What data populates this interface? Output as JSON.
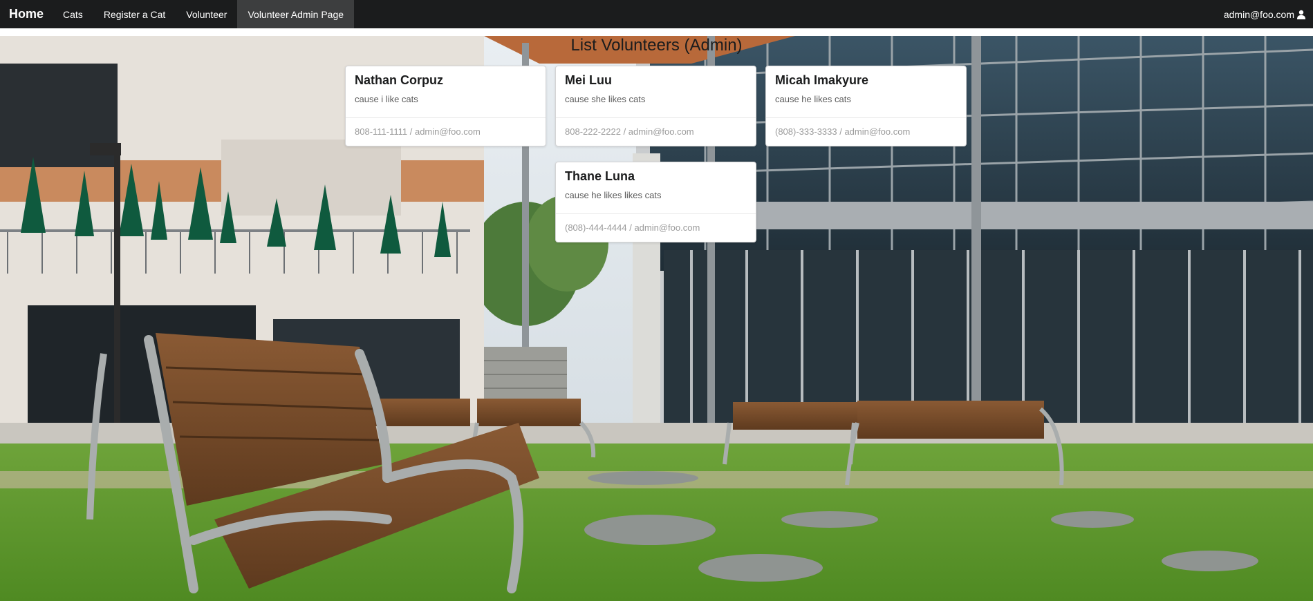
{
  "nav": {
    "brand": "Home",
    "items": [
      {
        "label": "Cats"
      },
      {
        "label": "Register a Cat"
      },
      {
        "label": "Volunteer"
      },
      {
        "label": "Volunteer Admin Page"
      }
    ],
    "user": "admin@foo.com"
  },
  "page": {
    "title": "List Volunteers (Admin)"
  },
  "volunteers": [
    {
      "name": "Nathan Corpuz",
      "reason": "cause i like cats",
      "contact": "808-111-1111 / admin@foo.com"
    },
    {
      "name": "Mei Luu",
      "reason": "cause she likes cats",
      "contact": "808-222-2222 / admin@foo.com"
    },
    {
      "name": "Micah Imakyure",
      "reason": "cause he likes cats",
      "contact": "(808)-333-3333 / admin@foo.com"
    },
    {
      "name": "Thane Luna",
      "reason": "cause he likes likes cats",
      "contact": "(808)-444-4444 / admin@foo.com"
    }
  ],
  "colors": {
    "navbar": "#1b1c1d",
    "active_tab": "#3d3e3f",
    "card_border": "#d4d4d5"
  },
  "icons": {
    "user": "user-icon"
  }
}
